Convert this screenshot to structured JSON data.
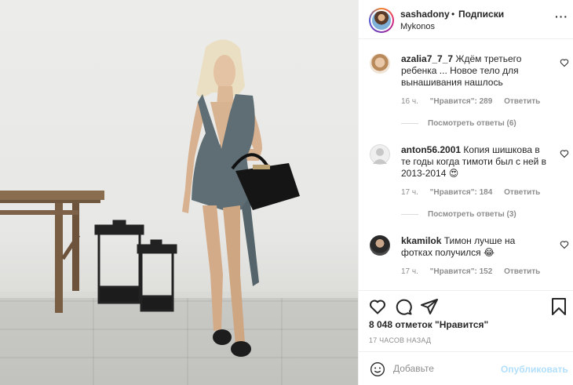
{
  "post": {
    "username": "sashadony",
    "separator": "•",
    "follow_label": "Подписки",
    "location": "Mykonos",
    "more_icon": "more-horizontal-icon"
  },
  "comments": [
    {
      "username": "azalia7_7_7",
      "text": "Ждём третьего ребенка ... Новое тело для вынашивания нашлось",
      "time": "16 ч.",
      "likes": "\"Нравится\": 289",
      "reply": "Ответить",
      "view_replies": "Посмотреть ответы (6)"
    },
    {
      "username": "anton56.2001",
      "text": "Копия шишкова в те годы когда тимоти был с ней в 2013-2014 😍",
      "time": "17 ч.",
      "likes": "\"Нравится\": 184",
      "reply": "Ответить",
      "view_replies": "Посмотреть ответы (3)"
    },
    {
      "username": "kkamilok",
      "text": "Тимон лучше на фотках получился 😂",
      "time": "17 ч.",
      "likes": "\"Нравится\": 152",
      "reply": "Ответить"
    }
  ],
  "actions": {
    "like_icon": "heart-icon",
    "comment_icon": "comment-icon",
    "share_icon": "share-icon",
    "save_icon": "bookmark-icon"
  },
  "likes_count": "8 048 отметок \"Нравится\"",
  "posted_time": "17 ЧАСОВ НАЗАД",
  "add_comment": {
    "placeholder": "Добавьте",
    "publish_label": "Опубликовать"
  },
  "colors": {
    "link_blue_disabled": "#b2dffc",
    "meta_gray": "#8e8e8e",
    "text": "#262626"
  }
}
